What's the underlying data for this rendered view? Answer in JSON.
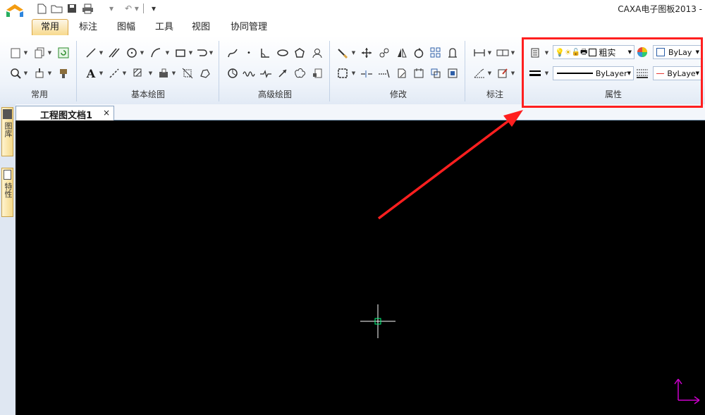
{
  "window": {
    "title": "CAXA电子图板2013 -"
  },
  "quick_access": {
    "icons": [
      "new-file-icon",
      "open-folder-icon",
      "save-icon",
      "print-icon",
      "undo-icon",
      "redo-icon",
      "customize-icon"
    ]
  },
  "tabs": [
    {
      "label": "常用",
      "active": true
    },
    {
      "label": "标注",
      "active": false
    },
    {
      "label": "图幅",
      "active": false
    },
    {
      "label": "工具",
      "active": false
    },
    {
      "label": "视图",
      "active": false
    },
    {
      "label": "协同管理",
      "active": false
    }
  ],
  "ribbon_groups": [
    "常用",
    "基本绘图",
    "高级绘图",
    "修改",
    "标注",
    "属性"
  ],
  "properties": {
    "layer_name": "粗实",
    "color_value": "ByLay",
    "linetype_value": "ByLayer",
    "lineweight_value": "ByLaye"
  },
  "document": {
    "tab_label": "工程图文档1",
    "close_glyph": "×"
  },
  "side_panels": [
    "图库",
    "特性"
  ],
  "colors": {
    "highlight_red": "#ff1f1f",
    "canvas_bg": "#000000",
    "crosshair": "#ffffff",
    "cursor_box": "#00ff80",
    "ucs": "#cc00cc"
  }
}
